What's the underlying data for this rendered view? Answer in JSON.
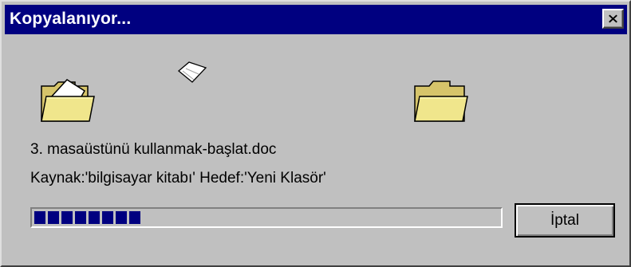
{
  "window": {
    "title": "Kopyalanıyor...",
    "title_bar_color": "#000080",
    "close_icon": "close-icon"
  },
  "copy": {
    "file_name": "3. masaüstünü kullanmak-başlat.doc",
    "path_text": "Kaynak:'bilgisayar kitabı' Hedef:'Yeni Klasör'"
  },
  "progress": {
    "filled_blocks": 8,
    "percent": 20,
    "color": "#000080"
  },
  "buttons": {
    "cancel_label": "İptal"
  },
  "icons": {
    "source": "open-folder-icon",
    "dest": "folder-icon",
    "flying": "paper-document-icon"
  }
}
